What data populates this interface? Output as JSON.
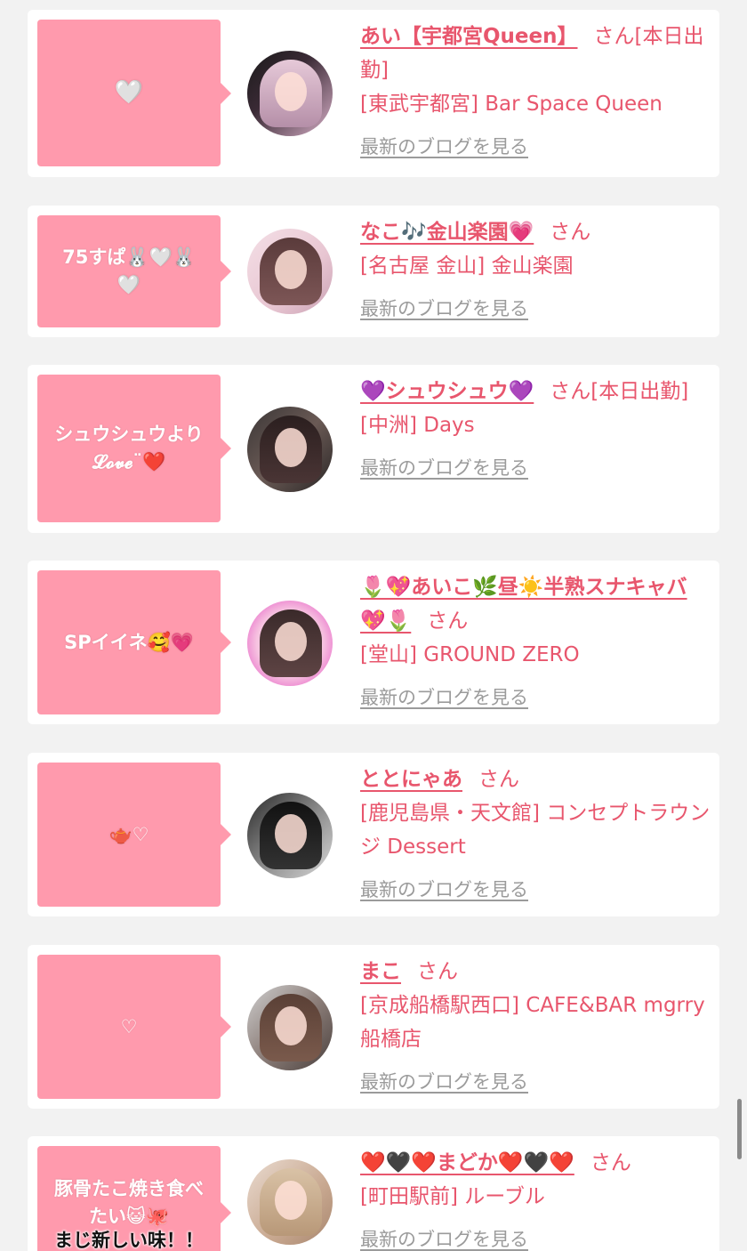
{
  "blog_link_label": "最新のブログを見る",
  "honorific": "さん",
  "accent_color": "#e8566d",
  "bubble_color": "#ff9aad",
  "entries": [
    {
      "message": "🤍",
      "name": "あい【宇都宮Queen】",
      "status": "[本日出勤]",
      "shop": "[東武宇都宮] Bar Space Queen",
      "avatar_icon": "avatar-photo"
    },
    {
      "message": "75すぱ🐰🤍🐰\n🤍",
      "name": "なこ🎶金山楽園💗",
      "status": "",
      "shop": "[名古屋 金山] 金山楽園",
      "avatar_icon": "avatar-photo"
    },
    {
      "message": "シュウシュウより\n𝓛𝓸𝓿𝓮¨❤️",
      "name": "💜シュウシュウ💜",
      "status": "[本日出勤]",
      "shop": "[中洲] Days",
      "avatar_icon": "avatar-photo"
    },
    {
      "message": "SPイイネ🥰💗",
      "name": "🌷💖あいこ🌿昼☀️半熟スナキャバ💖🌷",
      "status": "",
      "shop": "[堂山] GROUND ZERO",
      "avatar_icon": "avatar-photo"
    },
    {
      "message": "🫖♡",
      "name": "ととにゃあ",
      "status": "",
      "shop": "[鹿児島県・天文館] コンセプトラウンジ Dessert",
      "avatar_icon": "avatar-photo"
    },
    {
      "message": "♡",
      "name": "まこ",
      "status": "",
      "shop": "[京成船橋駅西口] CAFE&BAR mgrry 船橋店",
      "avatar_icon": "avatar-photo"
    },
    {
      "message": "豚骨たこ焼き食べたい😺🐙",
      "message_extra": "まじ新しい味！！",
      "name": "❤️🖤❤️まどか❤️🖤❤️",
      "status": "",
      "shop": "[町田駅前] ルーブル",
      "avatar_icon": "avatar-photo"
    }
  ]
}
